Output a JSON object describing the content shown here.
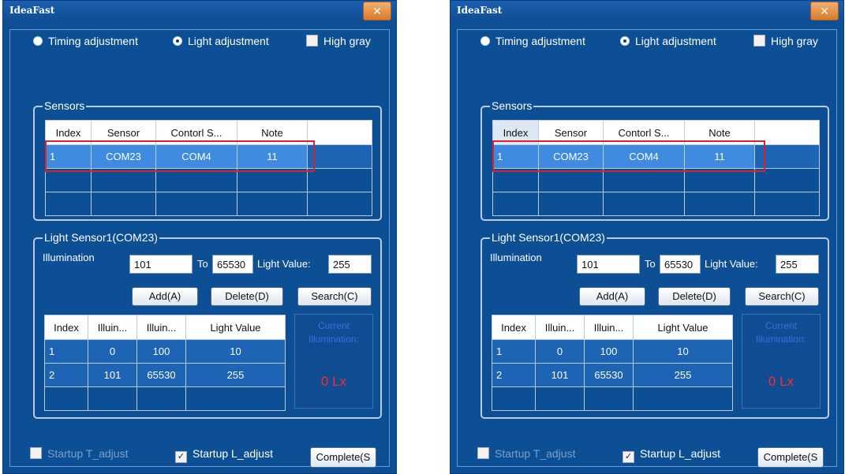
{
  "title": "IdeaFast",
  "close_icon": "close-icon",
  "options": {
    "timing": "Timing adjustment",
    "light": "Light adjustment",
    "high_gray": "High gray"
  },
  "sensors": {
    "label": "Sensors",
    "headers": [
      "Index",
      "Sensor",
      "Contorl S...",
      "Note"
    ],
    "rows": [
      [
        "1",
        "COM23",
        "COM4",
        "11"
      ]
    ]
  },
  "light_sensor": {
    "label": "Light Sensor1(COM23)",
    "illumination_label": "Illumination",
    "from_value": "101",
    "to_label": "To",
    "to_value": "65530",
    "light_value_label": "Light Value:",
    "light_value": "255",
    "add_button": "Add(A)",
    "delete_button": "Delete(D)",
    "search_button": "Search(C)",
    "headers": [
      "Index",
      "Illuin...",
      "Illuin...",
      "Light Value"
    ],
    "rows": [
      [
        "1",
        "0",
        "100",
        "10"
      ],
      [
        "2",
        "101",
        "65530",
        "255"
      ]
    ],
    "current_label": "Current Illumination:",
    "current_value": "0 Lx"
  },
  "footer": {
    "startup_t": "Startup T_adjust",
    "startup_l": "Startup L_adjust",
    "complete_button": "Complete(S"
  },
  "colors": {
    "window_bg": "#0d4f95",
    "selected_row": "#3f8be0",
    "highlight_box": "#d8232a",
    "current_value": "#ff2a2a"
  }
}
